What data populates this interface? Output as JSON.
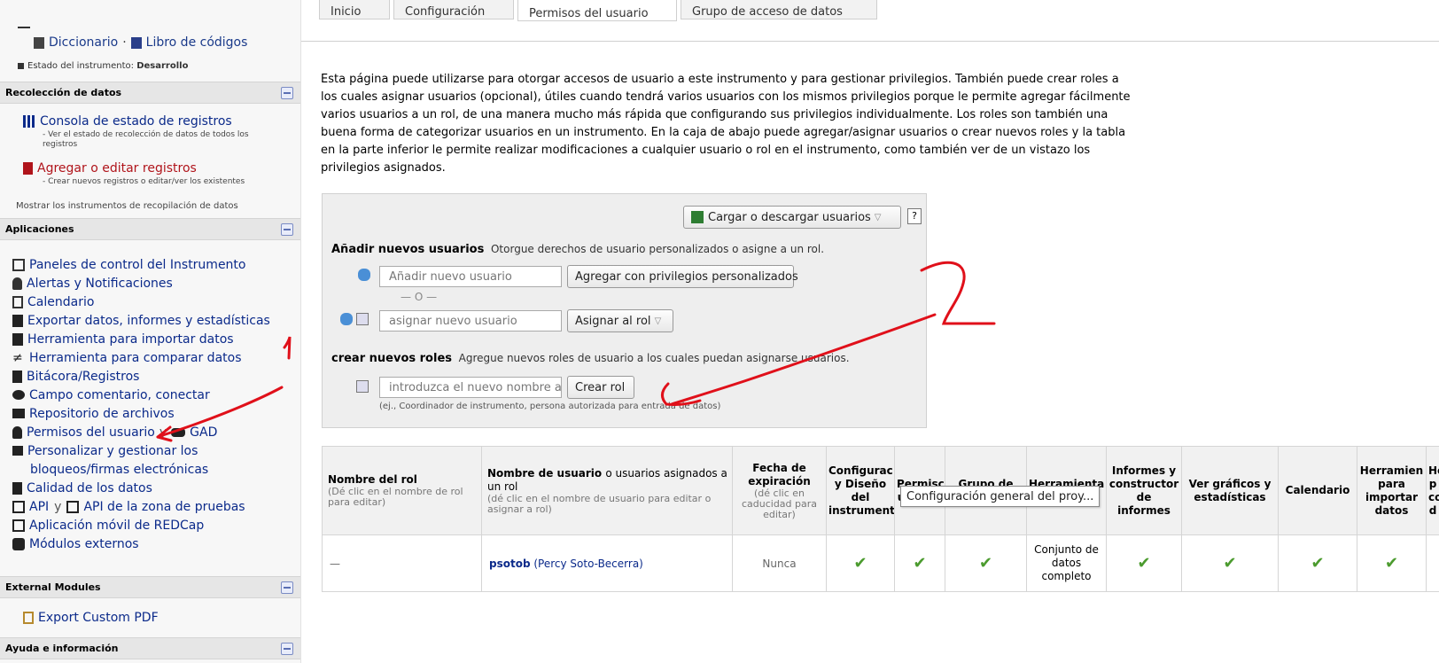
{
  "sidebar": {
    "dictionary_link": "Diccionario",
    "separator": "·",
    "codebook_link": "Libro de códigos",
    "status_label": "Estado del instrumento:",
    "status_value": "Desarrollo",
    "sections": {
      "data_collection": "Recolección de datos",
      "applications": "Aplicaciones",
      "external_modules": "External Modules",
      "help": "Ayuda e información"
    },
    "record_status": {
      "label": "Consola de estado de registros",
      "desc": "- Ver el estado de recolección de datos de todos los registros"
    },
    "add_edit": {
      "label": "Agregar o editar registros",
      "desc": "- Crear nuevos registros o editar/ver los existentes"
    },
    "show_instruments": "Mostrar los instrumentos de recopilación de datos",
    "apps": [
      {
        "label": "Paneles de control del Instrumento",
        "icon": "dashboard-icon"
      },
      {
        "label": "Alertas y Notificaciones",
        "icon": "bell-icon"
      },
      {
        "label": "Calendario",
        "icon": "calendar-icon"
      },
      {
        "label": "Exportar datos, informes y estadísticas",
        "icon": "export-icon"
      },
      {
        "label": "Herramienta para importar datos",
        "icon": "import-icon"
      },
      {
        "label": "Herramienta para comparar datos",
        "icon": "not-equal-icon"
      },
      {
        "label": "Bitácora/Registros",
        "icon": "log-icon"
      },
      {
        "label": "Campo comentario, conectar",
        "icon": "comments-icon"
      },
      {
        "label": "Repositorio de archivos",
        "icon": "folder-icon"
      }
    ],
    "user_rights": "Permisos del usuario",
    "and": "y",
    "gad": "GAD",
    "locking_1": "Personalizar y gestionar los",
    "locking_2": "bloqueos/firmas electrónicas",
    "data_quality": "Calidad de los datos",
    "api": "API",
    "api_playground": "API de la zona de pruebas",
    "mobile_app": "Aplicación móvil de REDCap",
    "external_modules_link": "Módulos externos",
    "export_pdf": "Export Custom PDF"
  },
  "tabs": [
    {
      "label": "Inicio",
      "active": false
    },
    {
      "label": "Configuración",
      "active": false
    },
    {
      "label": "Permisos del usuario",
      "active": true
    },
    {
      "label": "Grupo de acceso de datos",
      "active": false
    }
  ],
  "intro_text": "Esta página puede utilizarse para otorgar accesos de usuario a este instrumento y para gestionar privilegios. También puede crear roles a los cuales asignar usuarios (opcional), útiles cuando tendrá varios usuarios con los mismos privilegios porque le permite agregar fácilmente varios usuarios a un rol, de una manera mucho más rápida que configurando sus privilegios individualmente. Los roles son también una buena forma de categorizar usuarios en un instrumento. En la caja de abajo puede agregar/asignar usuarios o crear nuevos roles y la tabla en la parte inferior le permite realizar modificaciones a cualquier usuario o rol en el instrumento, como también ver de un vistazo los privilegios asignados.",
  "userbox": {
    "upload_download": "Cargar o descargar usuarios",
    "help": "?",
    "add_users_title": "Añadir nuevos usuarios",
    "add_users_desc": "Otorgue derechos de usuario personalizados o asigne a un rol.",
    "add_user_placeholder": "Añadir nuevo usuario",
    "add_custom_btn": "Agregar con privilegios personalizados",
    "or": "— O —",
    "assign_placeholder": "asignar nuevo usuario",
    "assign_btn": "Asignar al rol",
    "create_roles_title": "crear nuevos roles",
    "create_roles_desc": "Agregue nuevos roles de usuario a los cuales puedan asignarse usuarios.",
    "role_placeholder": "introduzca el nuevo nombre a",
    "create_role_btn": "Crear rol",
    "role_example": "(ej., Coordinador de instrumento, persona autorizada para entrada de datos)"
  },
  "table": {
    "headers": {
      "role_name": "Nombre del rol",
      "role_name_sub": "(Dé clic en el nombre de rol para editar)",
      "username": "Nombre de usuario",
      "username_rest": "o usuarios asignados a un rol",
      "username_sub": "(dé clic en el nombre de usuario para editar o asignar a rol)",
      "expiration": "Fecha de expiración",
      "expiration_sub": "(dé clic en caducidad para editar)",
      "design": "Configurac y Diseño del instrument",
      "user_rights": "Permisc usuario",
      "dag": "Grupo de datos",
      "export_tool": "Herramienta para datos",
      "reports": "Informes y constructor de informes",
      "graphs": "Ver gráficos y estadísticas",
      "calendar": "Calendario",
      "import_tool": "Herramien para importar datos",
      "compare_tool": "Herr p com d"
    },
    "row": {
      "role": "—",
      "username": "psotob",
      "fullname": "(Percy Soto-Becerra)",
      "expiration": "Nunca",
      "export_value": "Conjunto de datos completo",
      "check": "✔"
    },
    "tooltip": "Configuración general del proy..."
  },
  "annotations": {
    "number_one": "1",
    "number_two": "2",
    "ink_color": "#e0101a"
  }
}
